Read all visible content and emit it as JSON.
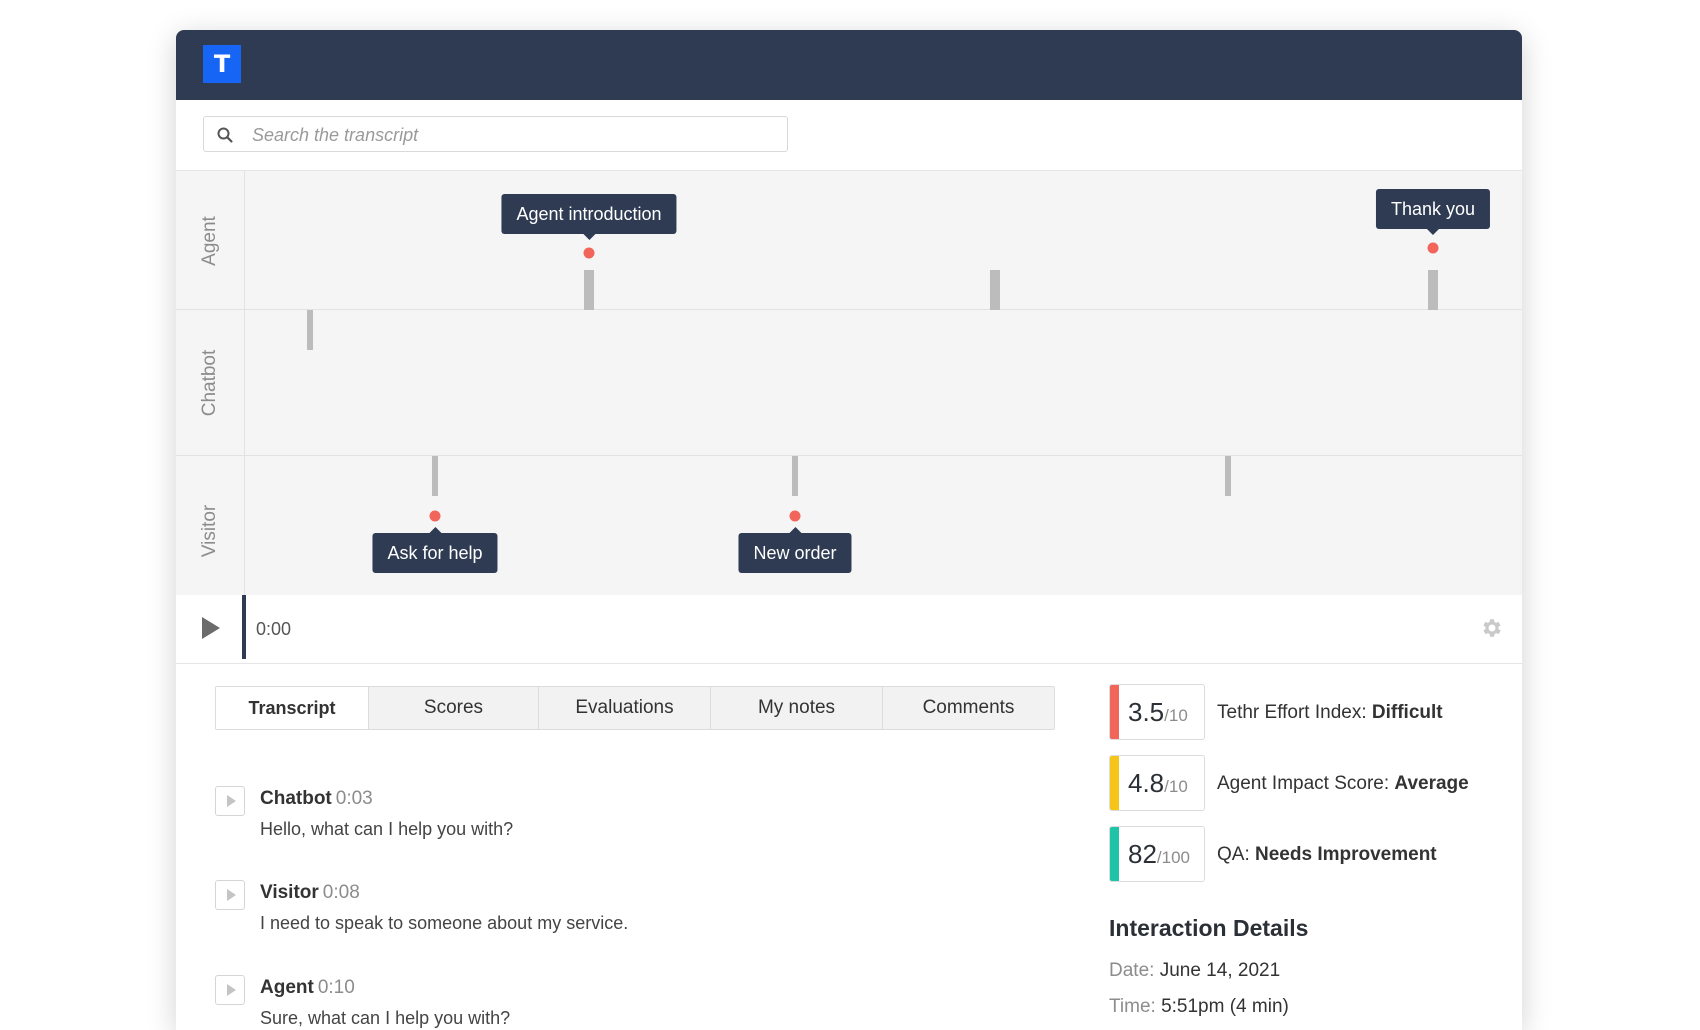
{
  "header": {
    "logo_letter": "T"
  },
  "search": {
    "placeholder": "Search the transcript",
    "value": ""
  },
  "timeline": {
    "lanes": [
      {
        "label": "Agent"
      },
      {
        "label": "Chatbot"
      },
      {
        "label": "Visitor"
      }
    ],
    "tags": {
      "agent_introduction": "Agent introduction",
      "thank_you": "Thank you",
      "ask_for_help": "Ask for help",
      "new_order": "New order"
    }
  },
  "player": {
    "current_time": "0:00"
  },
  "tabs": [
    {
      "label": "Transcript",
      "active": true
    },
    {
      "label": "Scores",
      "active": false
    },
    {
      "label": "Evaluations",
      "active": false
    },
    {
      "label": "My notes",
      "active": false
    },
    {
      "label": "Comments",
      "active": false
    }
  ],
  "transcript": [
    {
      "speaker": "Chatbot",
      "time": "0:03",
      "text": "Hello, what can I help you with?"
    },
    {
      "speaker": "Visitor",
      "time": "0:08",
      "text": "I need to speak to someone about my service."
    },
    {
      "speaker": "Agent",
      "time": "0:10",
      "text": "Sure, what can I help you with?"
    }
  ],
  "scores": [
    {
      "value": "3.5",
      "max": "/10",
      "label": "Tethr Effort Index: ",
      "level": "Difficult",
      "color": "#f2655b"
    },
    {
      "value": "4.8",
      "max": "/10",
      "label": "Agent Impact Score: ",
      "level": "Average",
      "color": "#f5c518"
    },
    {
      "value": "82",
      "max": "/100",
      "label": "QA: ",
      "level": "Needs Improvement",
      "color": "#1fc3a7"
    }
  ],
  "interaction_details": {
    "title": "Interaction Details",
    "date_label": "Date:",
    "date_value": "June 14, 2021",
    "time_label": "Time:",
    "time_value": "5:51pm (4 min)"
  },
  "colors": {
    "header_bg": "#2e3b52",
    "logo_bg": "#1665f5",
    "marker": "#f2655b"
  }
}
